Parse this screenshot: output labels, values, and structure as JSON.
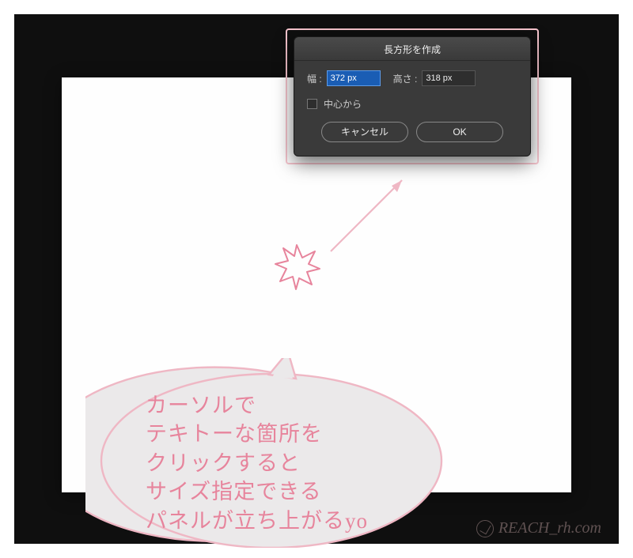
{
  "dialog": {
    "title": "長方形を作成",
    "width_label": "幅 :",
    "width_value": "372 px",
    "height_label": "高さ :",
    "height_value": "318 px",
    "center_label": "中心から",
    "cancel_label": "キャンセル",
    "ok_label": "OK"
  },
  "annotation": {
    "bubble_text": "カーソルで\nテキトーな箇所を\nクリックすると\nサイズ指定できる\nパネルが立ち上がるyo"
  },
  "watermark": {
    "text": "REACH_rh.com"
  },
  "colors": {
    "pink_border": "#f7c5ce",
    "bubble_fill": "#ebe9ea",
    "bubble_stroke": "#efb7c4",
    "text_pink": "#e7849c"
  }
}
